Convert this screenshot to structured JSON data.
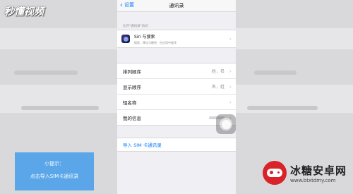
{
  "watermark": "秒懂视频",
  "navbar": {
    "back_label": "设置",
    "title": "通讯录"
  },
  "siri_section": {
    "header": "允许\"通讯录\"访问",
    "title": "Siri 与搜索",
    "subtitle": "搜索、建议与捷径、在应用中查找"
  },
  "settings_rows": [
    {
      "label": "排列顺序",
      "value": "姓，名"
    },
    {
      "label": "显示顺序",
      "value": "名，姓"
    },
    {
      "label": "短名称",
      "value": ""
    },
    {
      "label": "我的信息",
      "value": ""
    }
  ],
  "import_sim_label": "导入 SIM 卡通讯录",
  "tip": {
    "title": "小提示：",
    "body": "点击导入SIM卡通讯录"
  },
  "logo": {
    "name": "冰糖安卓网",
    "url": "www.btxtdmy.com"
  },
  "colors": {
    "accent": "#0a7bff",
    "tip_background": "#5aa6e8",
    "logo_red": "#d8232a"
  }
}
